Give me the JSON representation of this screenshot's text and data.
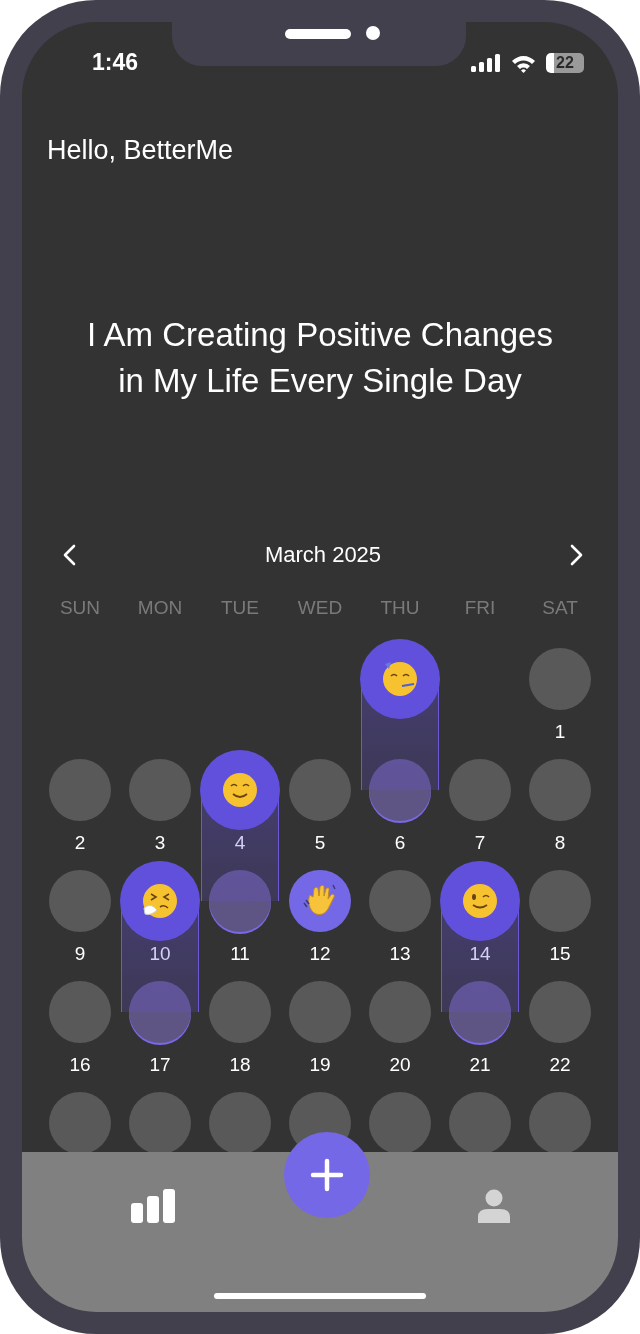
{
  "status_bar": {
    "time": "1:46",
    "battery": "22"
  },
  "greeting": "Hello, BetterMe",
  "affirmation": "I Am Creating Positive Changes in My Life Every Single Day",
  "calendar": {
    "month": "March 2025",
    "weekdays": [
      "SUN",
      "MON",
      "TUE",
      "WED",
      "THU",
      "FRI",
      "SAT"
    ],
    "weeks": [
      [
        {
          "kind": "empty"
        },
        {
          "kind": "empty"
        },
        {
          "kind": "empty"
        },
        {
          "kind": "empty"
        },
        {
          "kind": "empty"
        },
        {
          "kind": "empty"
        },
        {
          "kind": "day",
          "label": "1"
        }
      ],
      [
        {
          "kind": "day",
          "label": "2"
        },
        {
          "kind": "day",
          "label": "3"
        },
        {
          "kind": "day",
          "label": "4"
        },
        {
          "kind": "day",
          "label": "5"
        },
        {
          "kind": "day",
          "label": "6",
          "mood": {
            "kind": "partying",
            "raised": true
          }
        },
        {
          "kind": "day",
          "label": "7"
        },
        {
          "kind": "day",
          "label": "8"
        }
      ],
      [
        {
          "kind": "day",
          "label": "9"
        },
        {
          "kind": "day",
          "label": "10"
        },
        {
          "kind": "day",
          "label": "11",
          "mood": {
            "kind": "blissful",
            "raised": true
          }
        },
        {
          "kind": "day",
          "label": "12",
          "mood": {
            "kind": "waving",
            "raised": false
          }
        },
        {
          "kind": "day",
          "label": "13"
        },
        {
          "kind": "day",
          "label": "14"
        },
        {
          "kind": "day",
          "label": "15"
        }
      ],
      [
        {
          "kind": "day",
          "label": "16"
        },
        {
          "kind": "day",
          "label": "17",
          "mood": {
            "kind": "sneezing",
            "raised": true
          }
        },
        {
          "kind": "day",
          "label": "18"
        },
        {
          "kind": "day",
          "label": "19"
        },
        {
          "kind": "day",
          "label": "20"
        },
        {
          "kind": "day",
          "label": "21",
          "mood": {
            "kind": "winking",
            "raised": true
          }
        },
        {
          "kind": "day",
          "label": "22"
        }
      ],
      [
        {
          "kind": "cut"
        },
        {
          "kind": "cut"
        },
        {
          "kind": "cut"
        },
        {
          "kind": "cut"
        },
        {
          "kind": "cut"
        },
        {
          "kind": "cut"
        },
        {
          "kind": "cut"
        }
      ]
    ]
  }
}
